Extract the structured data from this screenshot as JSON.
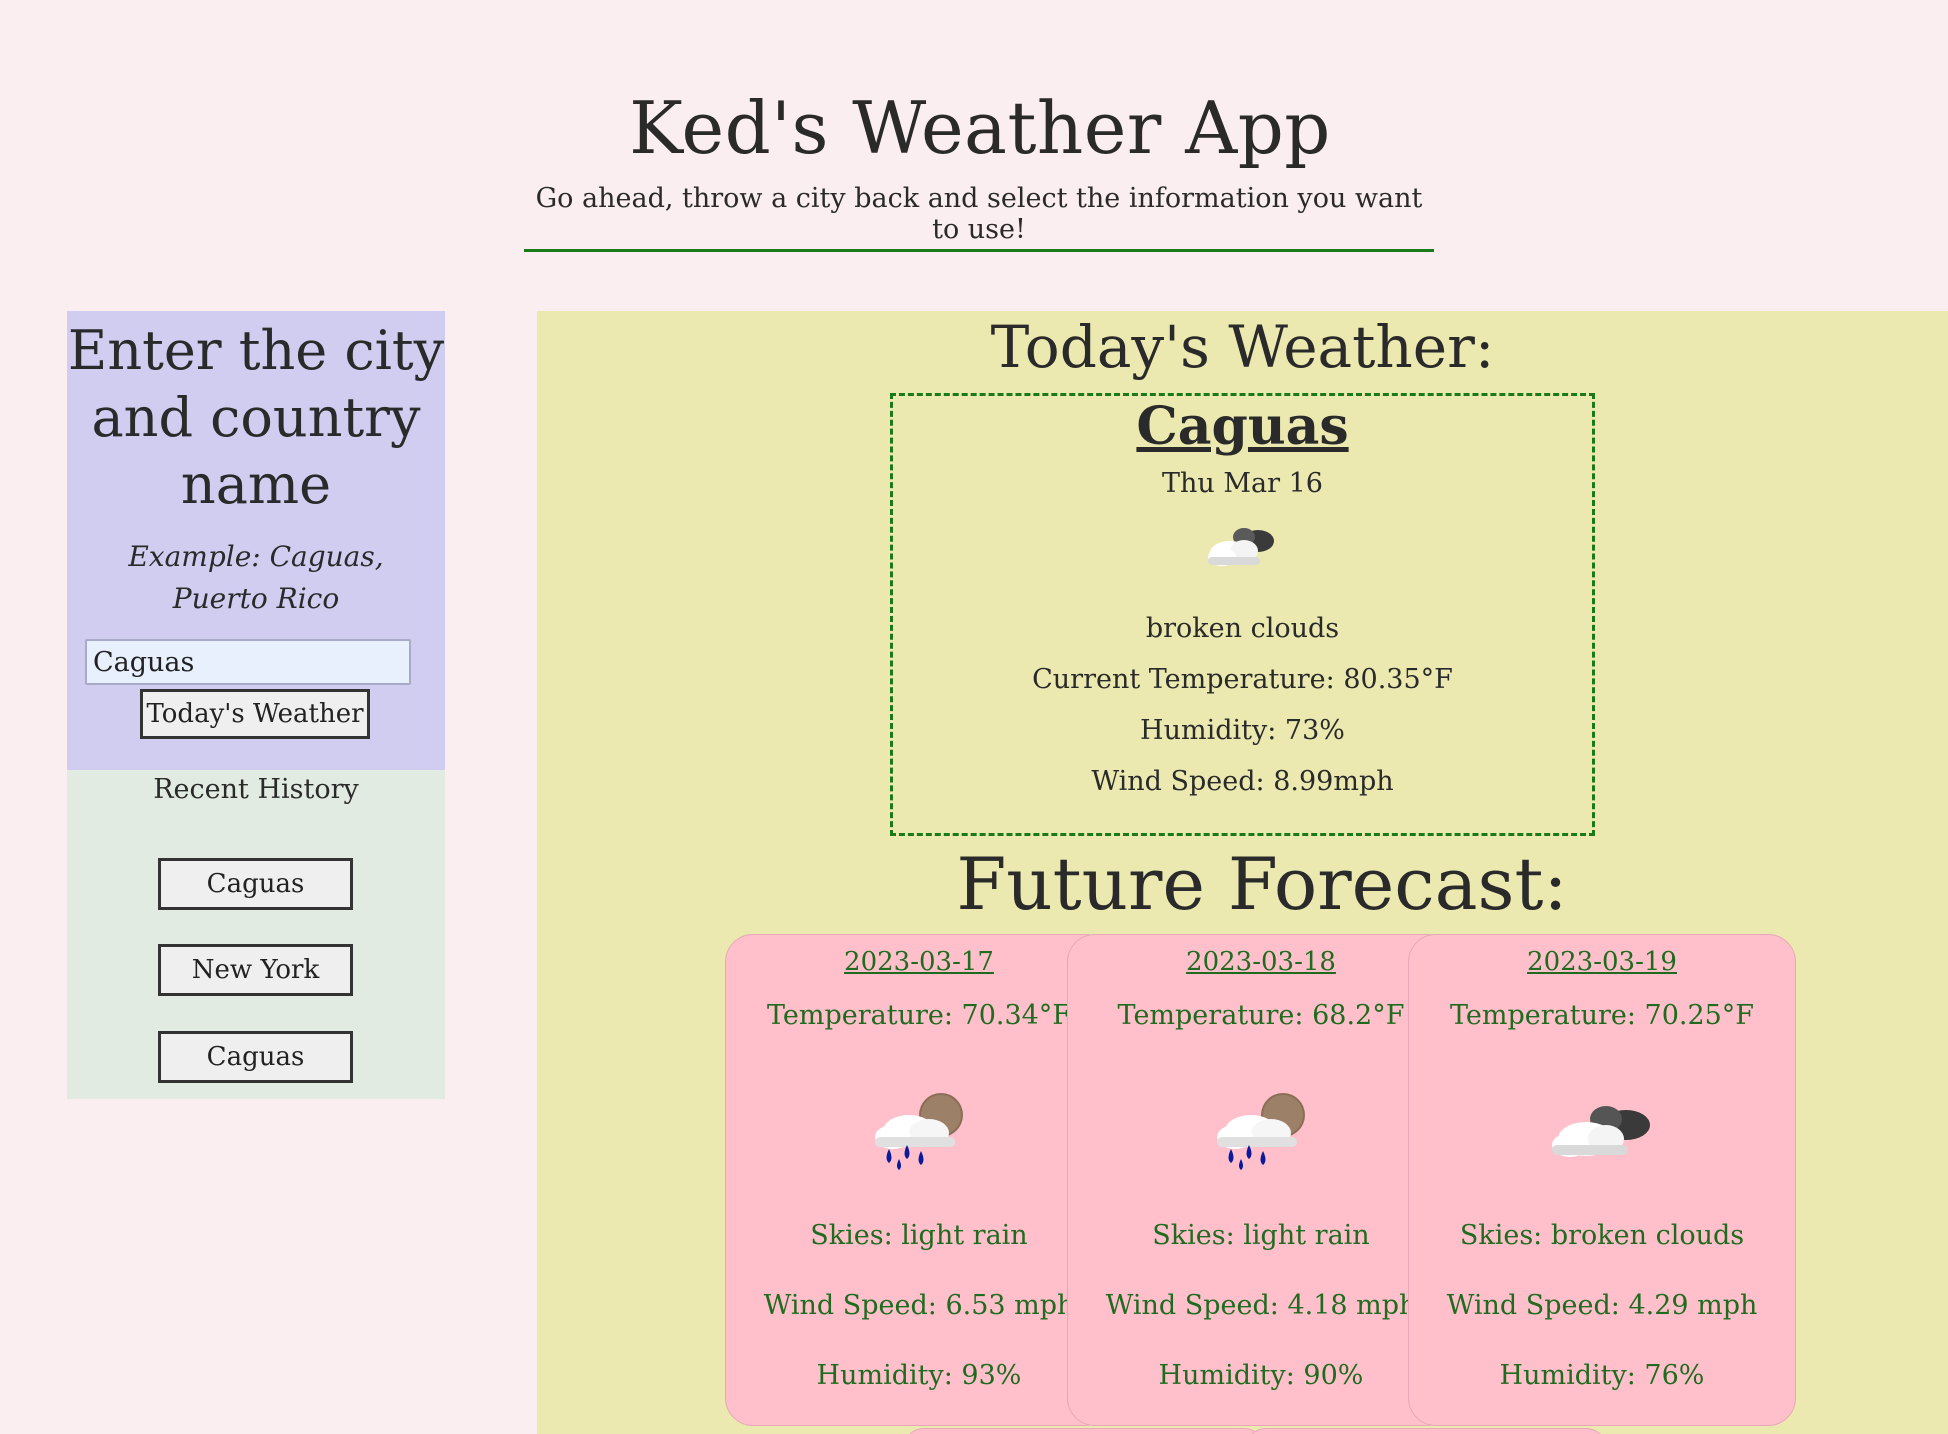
{
  "header": {
    "title": "Ked's Weather App",
    "subtitle": "Go ahead, throw a city back and select the information you want to use!"
  },
  "search": {
    "heading": "Enter the city and country name",
    "example": "Example: Caguas, Puerto Rico",
    "input_value": "Caguas",
    "button_label": "Today's Weather"
  },
  "history": {
    "title": "Recent History",
    "items": [
      "Caguas",
      "New York",
      "Caguas"
    ]
  },
  "today": {
    "heading": "Today's Weather:",
    "city": "Caguas",
    "date": "Thu Mar 16",
    "icon": "broken-clouds-icon",
    "description": "broken clouds",
    "temperature": "Current Temperature: 80.35°F",
    "humidity": "Humidity: 73%",
    "wind": "Wind Speed: 8.99mph"
  },
  "forecast": {
    "heading": "Future Forecast:",
    "cards": [
      {
        "date": "2023-03-17",
        "temperature": "Temperature: 70.34°F",
        "icon": "light-rain-icon",
        "skies": "Skies: light rain",
        "wind": "Wind Speed: 6.53 mph",
        "humidity": "Humidity: 93%"
      },
      {
        "date": "2023-03-18",
        "temperature": "Temperature: 68.2°F",
        "icon": "light-rain-icon",
        "skies": "Skies: light rain",
        "wind": "Wind Speed: 4.18 mph",
        "humidity": "Humidity: 90%"
      },
      {
        "date": "2023-03-19",
        "temperature": "Temperature: 70.25°F",
        "icon": "broken-clouds-icon",
        "skies": "Skies: broken clouds",
        "wind": "Wind Speed: 4.29 mph",
        "humidity": "Humidity: 76%"
      }
    ]
  },
  "colors": {
    "page_bg": "#faeef0",
    "search_bg": "#d0cdf0",
    "history_bg": "#e2ebe2",
    "main_bg": "#ebe9b0",
    "card_bg": "#ffc0cb",
    "accent_green": "#1a7a1a"
  }
}
